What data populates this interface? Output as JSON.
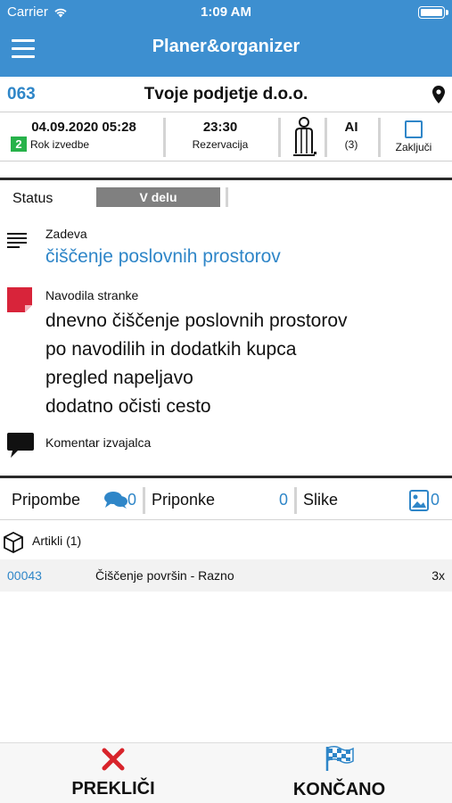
{
  "statusbar": {
    "carrier": "Carrier",
    "time": "1:09 AM"
  },
  "navbar": {
    "title": "Planer&organizer"
  },
  "order": {
    "number": "063",
    "client": "Tvoje podjetje d.o.o."
  },
  "info": {
    "date": "04.09.2020 05:28",
    "rok_badge": "2",
    "rok_label": "Rok izvedbe",
    "time": "23:30",
    "time_label": "Rezervacija",
    "ai": "AI",
    "ai_count": "(3)",
    "close_label": "Zaključi"
  },
  "status": {
    "label": "Status",
    "value": "V delu"
  },
  "zadeva": {
    "label": "Zadeva",
    "value": "čiščenje poslovnih prostorov"
  },
  "navodila": {
    "label": "Navodila stranke",
    "lines": [
      "dnevno čiščenje poslovnih prostorov",
      "po navodilih in dodatkih kupca",
      "pregled napeljavo",
      "dodatno očisti cesto"
    ]
  },
  "komentar": {
    "label": "Komentar izvajalca"
  },
  "attachments": {
    "pripombe_label": "Pripombe",
    "pripombe_count": "0",
    "priponke_label": "Priponke",
    "priponke_count": "0",
    "slike_label": "Slike",
    "slike_count": "0"
  },
  "articles": {
    "header": "Artikli (1)",
    "items": [
      {
        "code": "00043",
        "name": "Čiščenje površin - Razno",
        "qty": "3x"
      }
    ]
  },
  "actions": {
    "cancel_label": "PREKLIČI",
    "finish_label": "KONČANO"
  },
  "colors": {
    "header_blue": "#3d8fd0",
    "link_blue": "#2f86c8",
    "badge_green": "#27b24a",
    "cancel_red": "#d8242b",
    "note_red": "#d8243a",
    "status_gray": "#808080"
  },
  "icons": [
    "wifi-icon",
    "battery-icon",
    "hamburger-menu-icon",
    "map-pin-icon",
    "person-icon",
    "checkbox-icon",
    "text-lines-icon",
    "sticky-note-icon",
    "comment-icon",
    "chat-bubbles-icon",
    "image-icon",
    "box-icon",
    "close-x-icon",
    "checkered-flag-icon"
  ]
}
